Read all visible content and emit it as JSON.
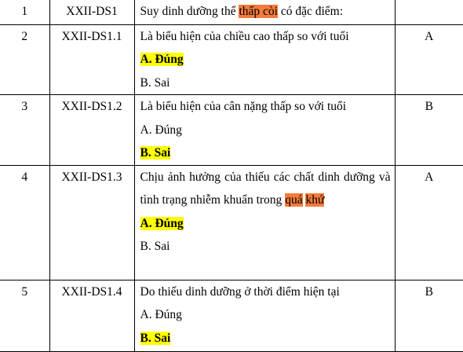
{
  "rows": [
    {
      "num": "1",
      "code": "XXII-DS1",
      "question": {
        "pre": "Suy dinh dưỡng thể ",
        "highlight": "thấp còi",
        "post": " có đặc điểm:"
      },
      "answer": ""
    },
    {
      "num": "2",
      "code": "XXII-DS1.1",
      "question": "Là biểu hiện của chiều cao thấp so với tuổi",
      "opt_a": "A. Đúng",
      "opt_b": "B. Sai",
      "answer": "A"
    },
    {
      "num": "3",
      "code": "XXII-DS1.2",
      "question": "Là biểu hiện của cân nặng thấp so với tuổi",
      "opt_a": "A. Đúng",
      "opt_b": "B. Sai",
      "answer": "B"
    },
    {
      "num": "4",
      "code": "XXII-DS1.3",
      "question": {
        "pre": "Chịu ảnh hưởng của thiếu các chất dinh dưỡng và tình trạng nhiễm khuẩn trong ",
        "highlight1": "quá",
        "highlight2": "khứ"
      },
      "opt_a": "A. Đúng",
      "opt_b": "B. Sai",
      "answer": "A"
    },
    {
      "num": "5",
      "code": "XXII-DS1.4",
      "question": "Do thiếu dinh dưỡng ở thời điểm hiện tại",
      "opt_a": "A. Đúng",
      "opt_b": "B. Sai",
      "answer": "B"
    }
  ],
  "colors": {
    "highlight_orange": "#f47b3b",
    "highlight_yellow": "#ffff00"
  }
}
